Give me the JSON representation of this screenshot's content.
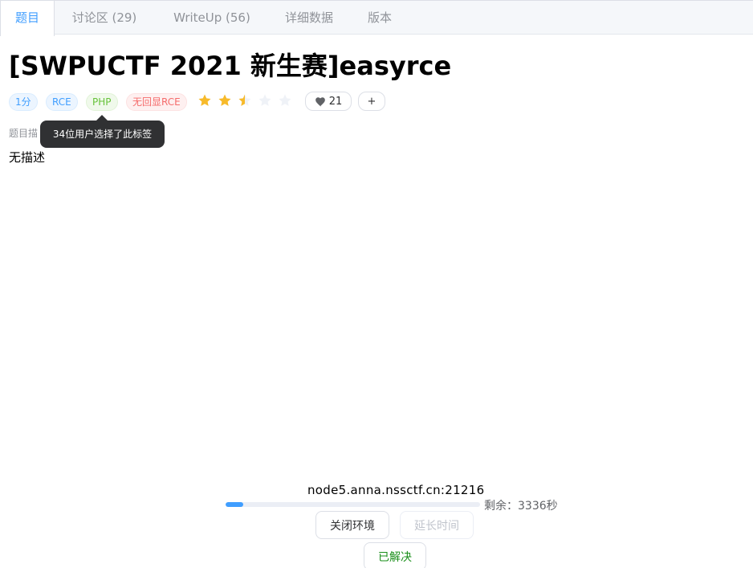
{
  "tabs": [
    {
      "label": "题目"
    },
    {
      "label": "讨论区 (29)"
    },
    {
      "label": "WriteUp (56)"
    },
    {
      "label": "详细数据"
    },
    {
      "label": "版本"
    }
  ],
  "problem": {
    "title": "[SWPUCTF 2021 新生赛]easyrce",
    "score": "1分",
    "tags": [
      "RCE",
      "PHP",
      "无回显RCE"
    ],
    "rating": 2.5,
    "rating_max": 5,
    "likes": "21",
    "add_label": "+",
    "description_label": "题目描",
    "description": "无描述"
  },
  "tooltip": {
    "text": "34位用户选择了此标签"
  },
  "environment": {
    "host": "node5.anna.nssctf.cn:21216",
    "remaining": "剩余：3336秒",
    "progress": 0.07,
    "close_label": "关闭环境",
    "extend_label": "延长时间",
    "solved_label": "已解决"
  },
  "colors": {
    "accent": "#409eff",
    "star": "#f7ba2a",
    "star_empty": "#eff2f7",
    "solved": "#1a8f1a"
  }
}
